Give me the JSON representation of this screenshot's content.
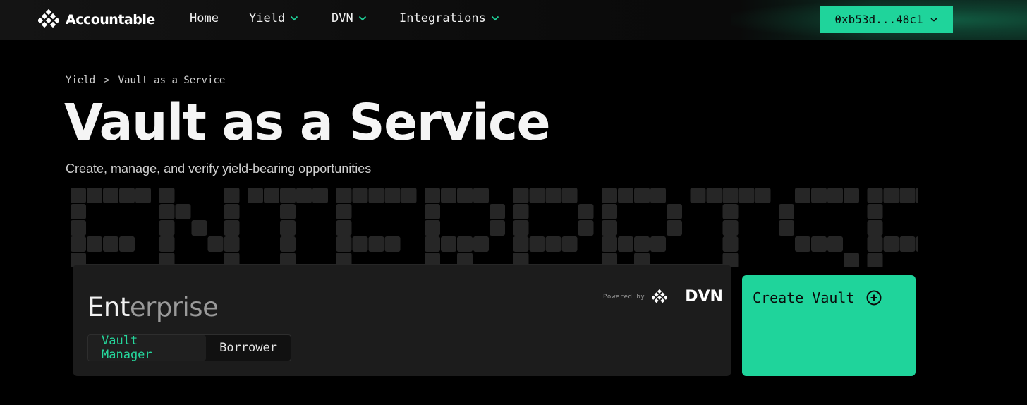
{
  "nav": {
    "brand": "Accountable",
    "links": [
      {
        "label": "Home",
        "has_dropdown": false
      },
      {
        "label": "Yield",
        "has_dropdown": true
      },
      {
        "label": "DVN",
        "has_dropdown": true
      },
      {
        "label": "Integrations",
        "has_dropdown": true
      }
    ],
    "wallet": "0xb53d...48c1"
  },
  "breadcrumb": {
    "items": [
      "Yield",
      "Vault as a Service"
    ],
    "separator": ">"
  },
  "page": {
    "title": "Vault as a Service",
    "subtitle": "Create, manage, and verify yield-bearing opportunities",
    "backdrop_word": "ENTERPRISE"
  },
  "card": {
    "title_main": "Ent",
    "title_fade": "erprise",
    "powered_by": "Powered by",
    "powered_brand": "DVN",
    "roles": [
      {
        "label": "Vault Manager",
        "active": true
      },
      {
        "label": "Borrower",
        "active": false
      }
    ]
  },
  "create_vault": {
    "label": "Create Vault"
  },
  "colors": {
    "accent": "#1fd49b",
    "background": "#000000",
    "card": "#1c1c1c",
    "backdrop_word": "#262626"
  }
}
